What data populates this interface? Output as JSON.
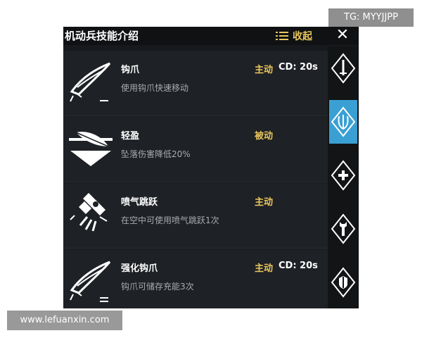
{
  "header": {
    "title": "机动兵技能介绍",
    "collapse_label": "收起",
    "close_glyph": "✕"
  },
  "skills": [
    {
      "name": "钩爪",
      "desc": "使用钩爪快速移动",
      "type": "主动",
      "cd": "CD: 20s",
      "icon": "grappling-hook-icon"
    },
    {
      "name": "轻盈",
      "desc": "坠落伤害降低20%",
      "type": "被动",
      "cd": "",
      "icon": "feather-icon"
    },
    {
      "name": "喷气跳跃",
      "desc": "在空中可使用喷气跳跃1次",
      "type": "主动",
      "cd": "",
      "icon": "jetpack-icon"
    },
    {
      "name": "强化钩爪",
      "desc": "钩爪可储存充能3次",
      "type": "主动",
      "cd": "CD: 20s",
      "icon": "enhanced-hook-icon"
    }
  ],
  "tabs": [
    {
      "icon": "dagger-icon",
      "active": false
    },
    {
      "icon": "mobile-soldier-icon",
      "active": true
    },
    {
      "icon": "plus-icon",
      "active": false
    },
    {
      "icon": "wrench-icon",
      "active": false
    },
    {
      "icon": "shield-icon",
      "active": false
    }
  ],
  "overlays": {
    "badge": "TG: MYYJJPP",
    "watermark": "www.lefuanxin.com"
  },
  "colors": {
    "accent": "#e9c65d",
    "active_tab": "#3aa0d4",
    "panel_bg": "#17191c"
  }
}
